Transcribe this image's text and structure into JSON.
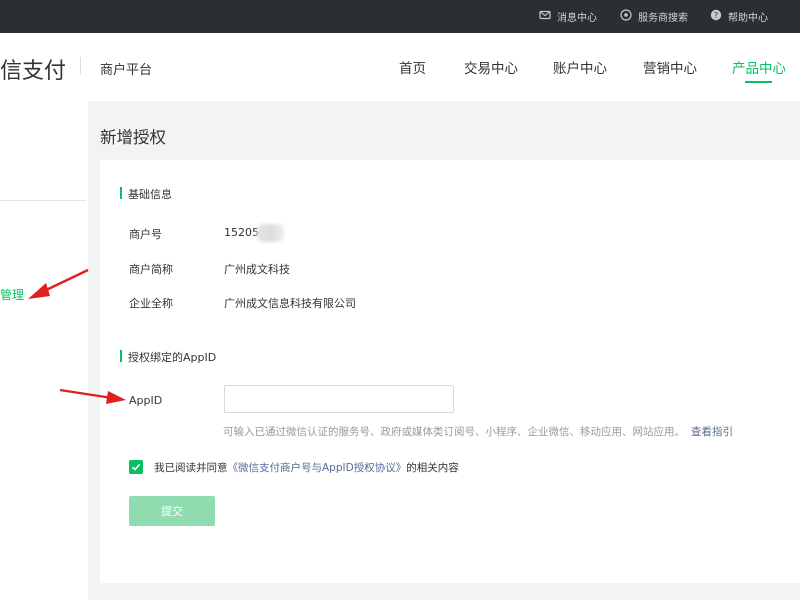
{
  "topbar": {
    "items": [
      {
        "label": "消息中心",
        "icon": "mail-icon"
      },
      {
        "label": "服务商搜索",
        "icon": "search-circle-icon"
      },
      {
        "label": "帮助中心",
        "icon": "help-icon"
      }
    ]
  },
  "header": {
    "brand": "信支付",
    "platform": "商户平台",
    "nav": [
      {
        "label": "首页"
      },
      {
        "label": "交易中心"
      },
      {
        "label": "账户中心"
      },
      {
        "label": "营销中心"
      },
      {
        "label": "产品中心",
        "active": true
      }
    ]
  },
  "sidebar": {
    "manage_label": "管理"
  },
  "page": {
    "title": "新增授权"
  },
  "basic_info": {
    "title": "基础信息",
    "rows": [
      {
        "label": "商户号",
        "value": "15205"
      },
      {
        "label": "商户简称",
        "value": "广州成文科技"
      },
      {
        "label": "企业全称",
        "value": "广州成文信息科技有限公司"
      }
    ]
  },
  "appid_section": {
    "title": "授权绑定的AppID",
    "field_label": "AppID",
    "input_value": "",
    "hint": "可输入已通过微信认证的服务号、政府或媒体类订阅号、小程序、企业微信、移动应用、网站应用。",
    "guide_link": "查看指引"
  },
  "agreement": {
    "checked": true,
    "prefix": "我已阅读并同意",
    "link": "《微信支付商户号与AppID授权协议》",
    "suffix": "的相关内容"
  },
  "submit_label": "提交",
  "colors": {
    "accent": "#07c160",
    "link": "#576b95",
    "annotation": "#e02020",
    "topbar": "#2b2e33"
  }
}
